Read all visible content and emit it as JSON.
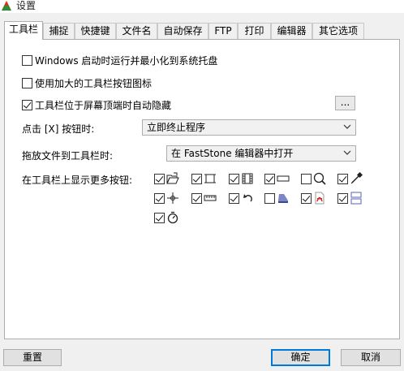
{
  "window": {
    "title": "设置"
  },
  "tabs": [
    {
      "label": "工具栏"
    },
    {
      "label": "捕捉"
    },
    {
      "label": "快捷键"
    },
    {
      "label": "文件名"
    },
    {
      "label": "自动保存"
    },
    {
      "label": "FTP"
    },
    {
      "label": "打印"
    },
    {
      "label": "编辑器"
    },
    {
      "label": "其它选项"
    }
  ],
  "options": {
    "startup": {
      "label": "Windows 启动时运行并最小化到系统托盘",
      "checked": false
    },
    "large_icons": {
      "label": "使用加大的工具栏按钮图标",
      "checked": false
    },
    "autohide": {
      "label": "工具栏位于屏幕顶端时自动隐藏",
      "checked": true
    }
  },
  "more_button": {
    "label": "..."
  },
  "close_action": {
    "label": "点击 [X] 按钮时:",
    "value": "立即终止程序"
  },
  "drag_action": {
    "label": "拖放文件到工具栏时:",
    "value": "在 FastStone 编辑器中打开"
  },
  "toolbar_buttons": {
    "label": "在工具栏上显示更多按钮:",
    "items": [
      {
        "icon": "open-folder-icon",
        "checked": true
      },
      {
        "icon": "fixed-region-icon",
        "checked": true
      },
      {
        "icon": "film-strip-icon",
        "checked": true
      },
      {
        "icon": "rectangle-icon",
        "checked": true
      },
      {
        "icon": "magnifier-icon",
        "checked": false
      },
      {
        "icon": "color-picker-icon",
        "checked": true
      },
      {
        "icon": "crosshair-icon",
        "checked": true
      },
      {
        "icon": "screen-ruler-icon",
        "checked": true
      },
      {
        "icon": "undo-arrow-icon",
        "checked": true
      },
      {
        "icon": "scanner-icon",
        "checked": false
      },
      {
        "icon": "pdf-icon",
        "checked": true
      },
      {
        "icon": "compare-screens-icon",
        "checked": true
      },
      {
        "icon": "timer-icon",
        "checked": true
      }
    ]
  },
  "footer": {
    "reset": "重置",
    "ok": "确定",
    "cancel": "取消"
  },
  "colors": {
    "accent": "#0078d7",
    "panel": "#ffffff",
    "background": "#f0f0f0"
  }
}
